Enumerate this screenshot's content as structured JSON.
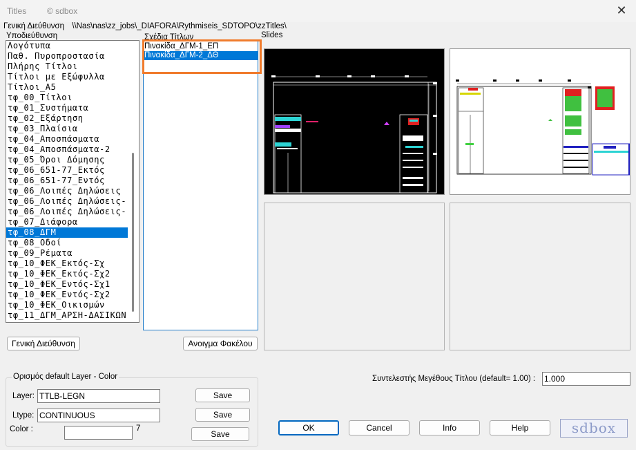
{
  "window": {
    "title": "Titles",
    "copyright": "© sdbox",
    "close_glyph": "✕"
  },
  "path": {
    "label": "Γενική Διεύθυνση",
    "value": "\\\\Nas\\nas\\zz_jobs\\_DIAFORA\\Rythmiseis_SDTOPO\\zzTitles\\"
  },
  "folders": {
    "label": "Υποδιεύθυνση",
    "items": [
      "Λογότυπα",
      "Παθ. Πυροπροστασία",
      "Πλήρης Τίτλοι",
      "Τίτλοι με Εξώφυλλα",
      "Τίτλοι_Α5",
      "τφ_00_Τίτλοι",
      "τφ_01_Συστήματα",
      "τφ_02_Εξάρτηση",
      "τφ_03_Πλαίσια",
      "τφ_04_Αποσπάσματα",
      "τφ_04_Αποσπάσματα-2",
      "τφ_05_Όροι Δόμησης",
      "τφ_06_651-77_Εκτός",
      "τφ_06_651-77_Εντός",
      "τφ_06_Λοιπές Δηλώσεις",
      "τφ_06_Λοιπές Δηλώσεις-",
      "τφ_06_Λοιπές Δηλώσεις-",
      "τφ_07_Διάφορα",
      "τφ_08_ΔΓΜ",
      "τφ_08_Οδοί",
      "τφ_09_Ρέματα",
      "τφ_10_ΦΕΚ_Εκτός-Σχ",
      "τφ_10_ΦΕΚ_Εκτός-Σχ2",
      "τφ_10_ΦΕΚ_Εντός-Σχ1",
      "τφ_10_ΦΕΚ_Εντός-Σχ2",
      "τφ_10_ΦΕΚ_Οικισμών",
      "τφ_11_ΔΓΜ_ΑΡΣΗ-ΔΑΣΙΚΩΝ"
    ],
    "selected_index": 18
  },
  "titles": {
    "label": "Σχέδια Τίτλων",
    "items": [
      "Πινακίδα_ΔΓΜ-1_ΕΠ",
      "Πινακίδα_ΔΓΜ-2_ΔΘ"
    ],
    "selected_index": 1
  },
  "slides": {
    "label": "Slides"
  },
  "buttons": {
    "general_dir": "Γενική Διεύθυνση",
    "open_folder": "Ανοιγμα Φακέλου",
    "save": "Save",
    "ok": "OK",
    "cancel": "Cancel",
    "info": "Info",
    "help": "Help"
  },
  "defaults": {
    "legend": "Ορισμός default Layer - Color",
    "layer_label": "Layer:",
    "layer_value": "TTLB-LEGN",
    "ltype_label": "Ltype:",
    "ltype_value": "CONTINUOUS",
    "color_label": "Color  :",
    "color_value": "",
    "color_index": "7"
  },
  "scale": {
    "label": "Συντελεστής Μεγέθους Τίτλου  (default= 1.00) :",
    "value": "1.000"
  },
  "logo": {
    "text": "sdbox"
  },
  "colors": {
    "selection": "#0078d7",
    "highlight_box": "#f07b2c",
    "logo": "#8c9ac8"
  }
}
